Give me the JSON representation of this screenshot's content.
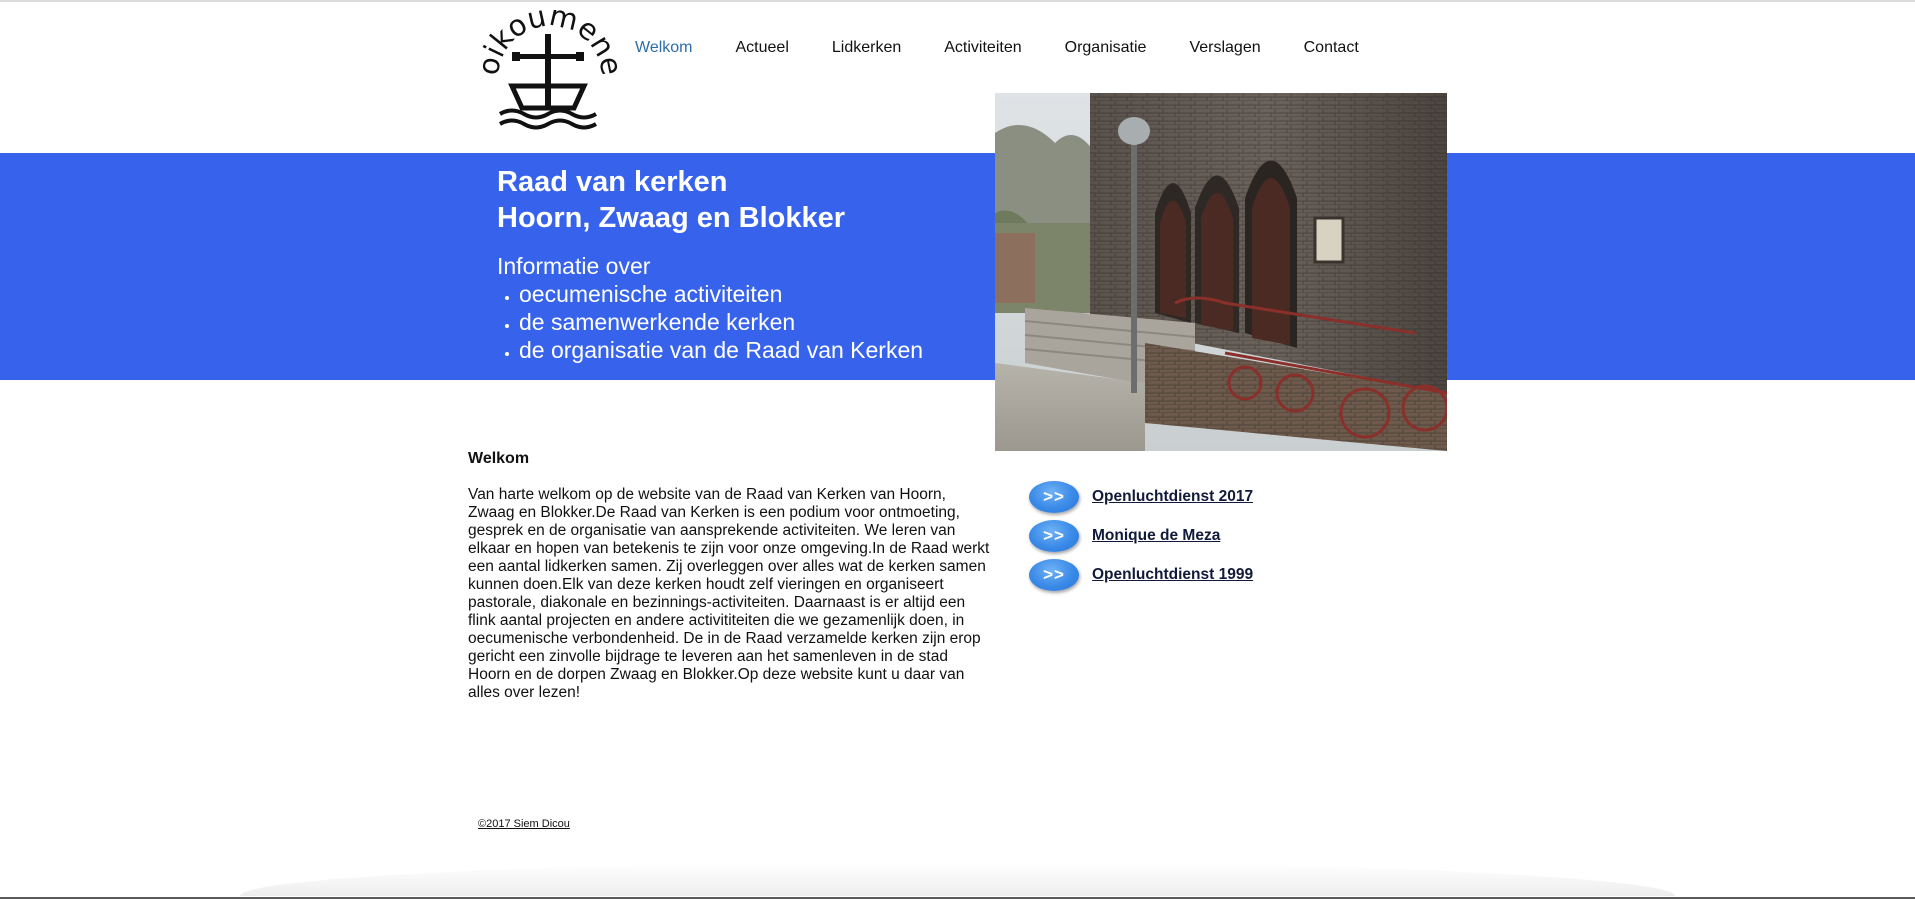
{
  "nav": {
    "items": [
      {
        "label": "Welkom",
        "active": true
      },
      {
        "label": "Actueel",
        "active": false
      },
      {
        "label": "Lidkerken",
        "active": false
      },
      {
        "label": "Activiteiten",
        "active": false
      },
      {
        "label": "Organisatie",
        "active": false
      },
      {
        "label": "Verslagen",
        "active": false
      },
      {
        "label": "Contact",
        "active": false
      }
    ]
  },
  "logo": {
    "text": "oikoumene",
    "icon": "boat-with-cross-icon"
  },
  "banner": {
    "title_line1": "Raad van kerken",
    "title_line2": "Hoorn, Zwaag en Blokker",
    "info_heading": "Informatie over",
    "bullets": [
      "oecumenische activiteiten",
      "de samenwerkende kerken",
      "de organisatie van de Raad van Kerken"
    ],
    "color": "#3763ec"
  },
  "photo": {
    "icon": "church-entrance-photo"
  },
  "welcome": {
    "heading": "Welkom",
    "body": "Van harte welkom op de website van de Raad van Kerken van Hoorn, Zwaag en Blokker.De Raad van Kerken is een podium voor ontmoeting, gesprek en de organisatie van aansprekende activiteiten. We leren van elkaar en hopen van betekenis te zijn voor onze omgeving.In de Raad werkt een aantal lidkerken samen. Zij overleggen over alles wat de kerken samen kunnen doen.Elk van deze kerken houdt zelf vieringen en organiseert pastorale, diakonale en bezinnings-activiteiten. Daarnaast is er altijd een flink aantal projecten en andere activititeiten die we gezamenlijk doen, in oecumenische verbondenheid. De in de Raad verzamelde kerken zijn erop gericht een zinvolle bijdrage te leveren aan het samenleven in de stad Hoorn en de dorpen Zwaag en Blokker.Op deze website kunt u daar van alles over lezen!"
  },
  "links": {
    "arrow_label": ">>",
    "items": [
      {
        "label": "Openluchtdienst 2017"
      },
      {
        "label": "Monique de Meza"
      },
      {
        "label": "Openluchtdienst 1999"
      }
    ]
  },
  "footer": {
    "text": "©2017 Siem Dicou "
  }
}
